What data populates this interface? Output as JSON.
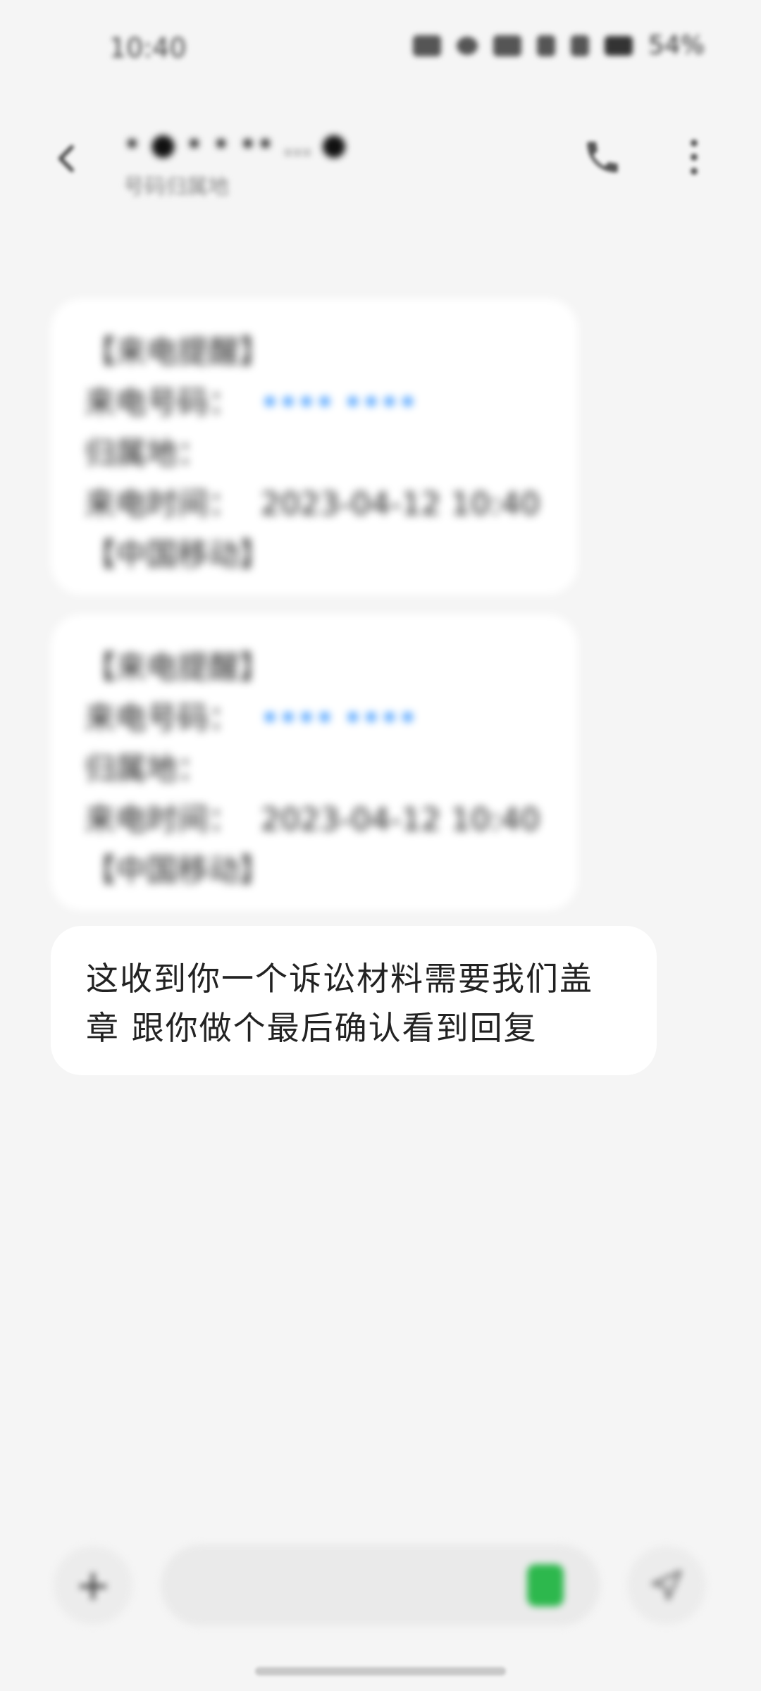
{
  "status_bar": {
    "time": "10:40",
    "battery": "54%"
  },
  "header": {
    "contact_name": "• ● • • •• ... ●",
    "contact_subtitle": "号码归属地"
  },
  "date_divider": "",
  "messages": [
    {
      "lines": [
        {
          "label": "【来电提醒】",
          "value": ""
        },
        {
          "label": "来电号码：",
          "value": "•••• ••••"
        },
        {
          "label": "归属地：",
          "value": ""
        },
        {
          "label": "来电时间：",
          "value": "2023-04-12 10:40"
        },
        {
          "label": "【中国移动】",
          "value": ""
        }
      ]
    },
    {
      "lines": [
        {
          "label": "【来电提醒】",
          "value": ""
        },
        {
          "label": "来电号码：",
          "value": "•••• ••••"
        },
        {
          "label": "归属地：",
          "value": ""
        },
        {
          "label": "来电时间：",
          "value": "2023-04-12 10:40"
        },
        {
          "label": "【中国移动】",
          "value": ""
        }
      ]
    },
    {
      "text_line1": "这收到你一个诉讼材料需要我们盖",
      "text_line2": "章  跟你做个最后确认看到回复"
    }
  ],
  "input": {
    "placeholder": "",
    "add_icon": "plus-icon",
    "send_icon": "send-icon",
    "sim_color": "#2db84d"
  },
  "colors": {
    "background": "#f5f5f5",
    "bubble": "#ffffff",
    "link": "#1e88ff"
  }
}
